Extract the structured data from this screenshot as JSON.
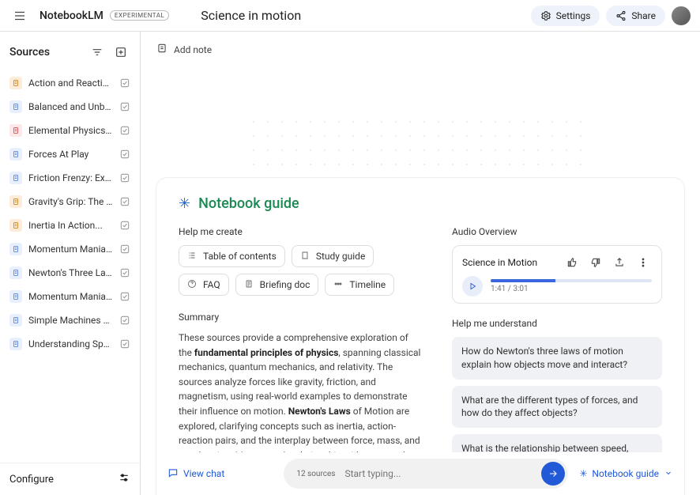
{
  "brand": "NotebookLM",
  "badge": "EXPERIMENTAL",
  "notebook_title": "Science in motion",
  "settings_label": "Settings",
  "share_label": "Share",
  "sources_header": "Sources",
  "configure_label": "Configure",
  "add_note_label": "Add note",
  "guide_header": "Notebook guide",
  "help_create_label": "Help me create",
  "chips": {
    "toc": "Table of contents",
    "study_guide": "Study guide",
    "faq": "FAQ",
    "briefing": "Briefing doc",
    "timeline": "Timeline"
  },
  "summary_label": "Summary",
  "summary": {
    "pre": "These sources provide a comprehensive exploration of the ",
    "bold1": "fundamental principles of physics",
    "mid": ", spanning classical mechanics, quantum mechanics, and relativity. The sources analyze forces like gravity, friction, and magnetism, using real-world examples to demonstrate their influence on motion. ",
    "bold2": "Newton's Laws",
    "post": " of Motion are explored, clarifying concepts such as inertia, action-reaction pairs, and the interplay between force, mass, and acceleration. Momentum's relationship with mass and velocity is also examined in the sources."
  },
  "audio_overview_label": "Audio Overview",
  "audio": {
    "title": "Science in Motion",
    "elapsed": "1:41",
    "total": "3:01",
    "progress_pct": 40
  },
  "help_understand_label": "Help me understand",
  "questions": [
    "How do Newton's three laws of motion explain how objects move and interact?",
    "What are the different types of forces, and how do they affect objects?",
    "What is the relationship between speed, velocity, acceleration, and momentum?"
  ],
  "view_chat_label": "View chat",
  "sources_count_label": "12 sources",
  "chat_placeholder": "Start typing...",
  "notebook_guide_btn": "Notebook guide",
  "sources": [
    {
      "name": "Action and Reaction",
      "kind": "orange"
    },
    {
      "name": "Balanced and Unbalance...",
      "kind": "doc"
    },
    {
      "name": "Elemental Physics, Third...",
      "kind": "red"
    },
    {
      "name": "Forces At Play",
      "kind": "doc"
    },
    {
      "name": "Friction Frenzy: Explorin...",
      "kind": "doc"
    },
    {
      "name": "Gravity's Grip: The Force...",
      "kind": "orange"
    },
    {
      "name": "Inertia In Action...",
      "kind": "orange"
    },
    {
      "name": "Momentum Mania: Inves...",
      "kind": "doc"
    },
    {
      "name": "Newton's Three Laws...",
      "kind": "doc"
    },
    {
      "name": "Momentum Mania: Inves...",
      "kind": "doc"
    },
    {
      "name": "Simple Machines Make...",
      "kind": "doc"
    },
    {
      "name": "Understanding Speed, Ve...",
      "kind": "doc"
    }
  ]
}
